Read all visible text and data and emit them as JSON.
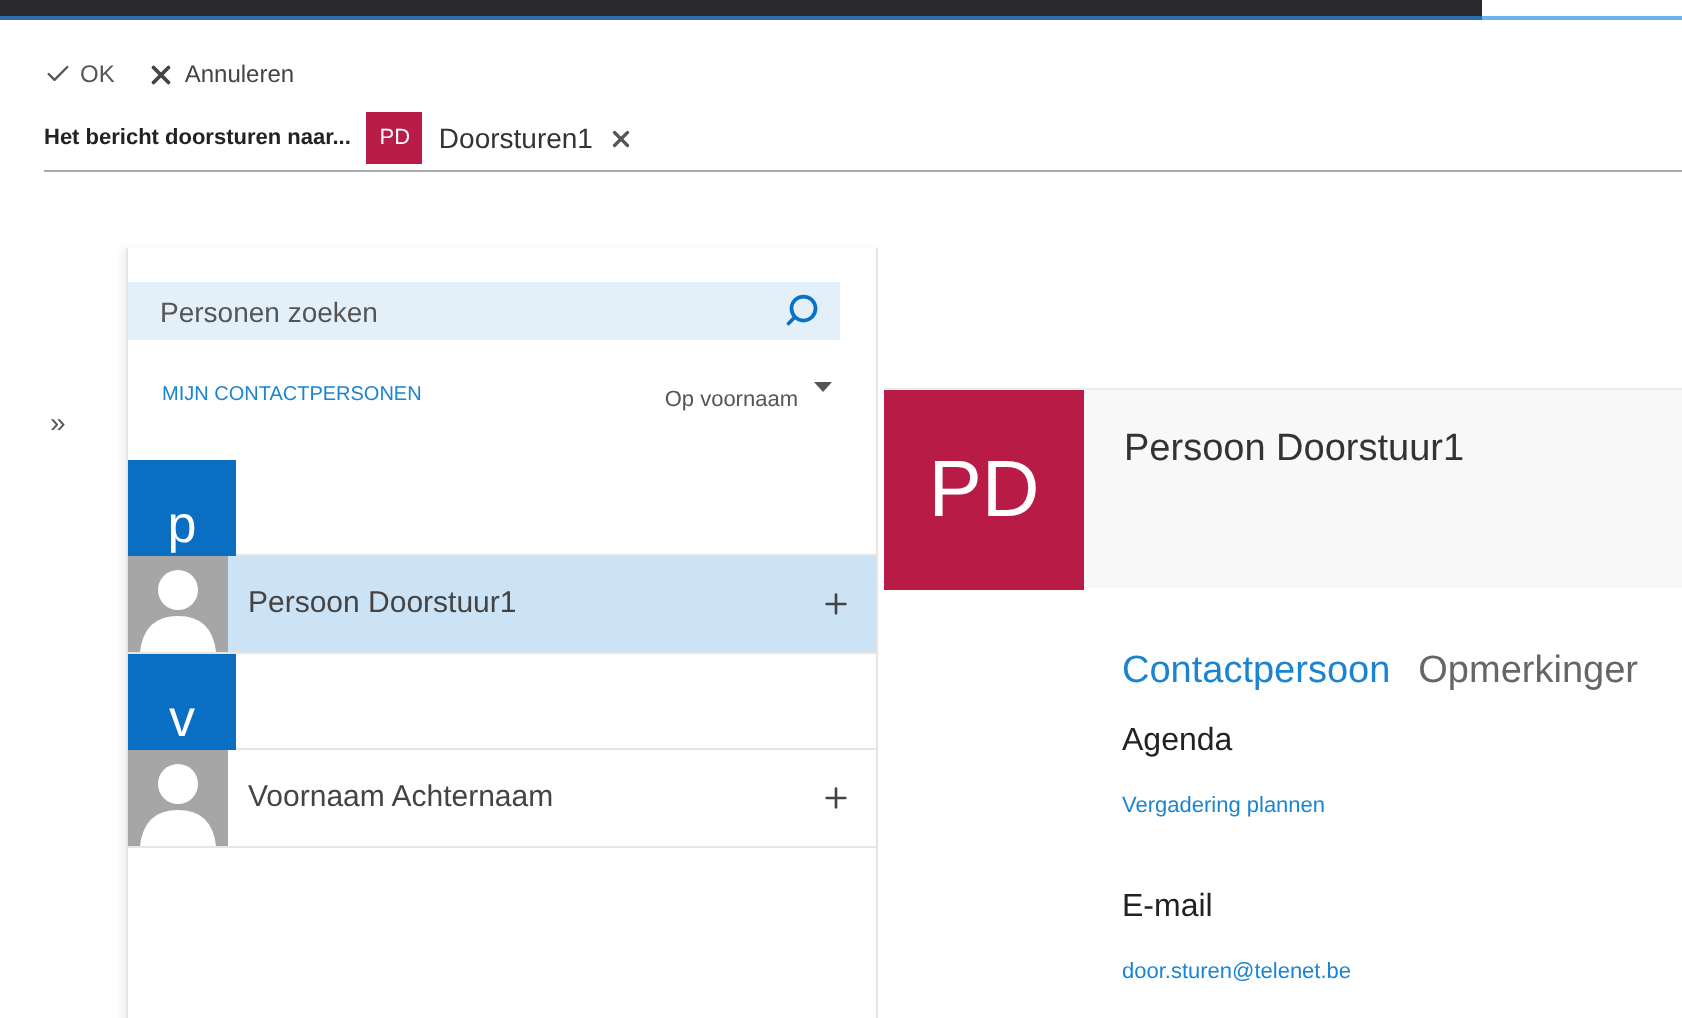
{
  "toolbar": {
    "ok": "OK",
    "cancel": "Annuleren"
  },
  "forward": {
    "label": "Het bericht doorsturen naar...",
    "recipients": [
      {
        "initials": "PD",
        "name": "Doorsturen1",
        "color": "#b91c47"
      }
    ]
  },
  "search": {
    "placeholder": "Personen zoeken"
  },
  "list_header": {
    "title": "MIJN CONTACTPERSONEN",
    "sort": "Op voornaam"
  },
  "expand": "»",
  "contacts": [
    {
      "kind": "letter",
      "text": "p"
    },
    {
      "kind": "contact",
      "name": "Persoon Doorstuur1",
      "selected": true
    },
    {
      "kind": "letter",
      "text": "v"
    },
    {
      "kind": "contact",
      "name": "Voornaam Achternaam",
      "selected": false
    }
  ],
  "detail": {
    "initials": "PD",
    "name": "Persoon Doorstuur1",
    "tabs": [
      {
        "label": "Contactpersoon",
        "selected": true
      },
      {
        "label": "Opmerkinger",
        "selected": false
      }
    ],
    "sections": [
      {
        "title": "Agenda",
        "link": "Vergadering plannen"
      },
      {
        "title": "E-mail",
        "link": "door.sturen@telenet.be"
      }
    ]
  }
}
